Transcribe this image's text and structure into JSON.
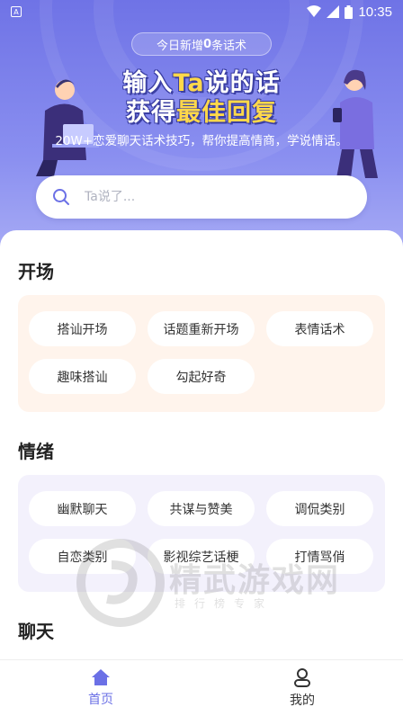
{
  "status_bar": {
    "time": "10:35",
    "app_icon": "A"
  },
  "hero": {
    "pill_prefix": "今日新增",
    "pill_count": "0",
    "pill_suffix": "条话术",
    "headline1_a": "输入",
    "headline1_b": "Ta",
    "headline1_c": "说的话",
    "headline2_a": "获得",
    "headline2_b": "最佳回复",
    "subtitle": "20W+恋爱聊天话术技巧，帮你提高情商，学说情话。"
  },
  "search": {
    "placeholder": "Ta说了..."
  },
  "sections": [
    {
      "title": "开场",
      "tags": [
        "搭讪开场",
        "话题重新开场",
        "表情话术",
        "趣味搭讪",
        "勾起好奇"
      ]
    },
    {
      "title": "情绪",
      "tags": [
        "幽默聊天",
        "共谋与赞美",
        "调侃类别",
        "自恋类别",
        "影视综艺话梗",
        "打情骂俏"
      ]
    },
    {
      "title": "聊天"
    }
  ],
  "tabbar": {
    "home": "首页",
    "mine": "我的"
  },
  "colors": {
    "accent": "#6b70e6",
    "hero": "#7a7fe9",
    "panel_orange": "#fff4ec",
    "panel_purple": "#f3f1fc"
  }
}
